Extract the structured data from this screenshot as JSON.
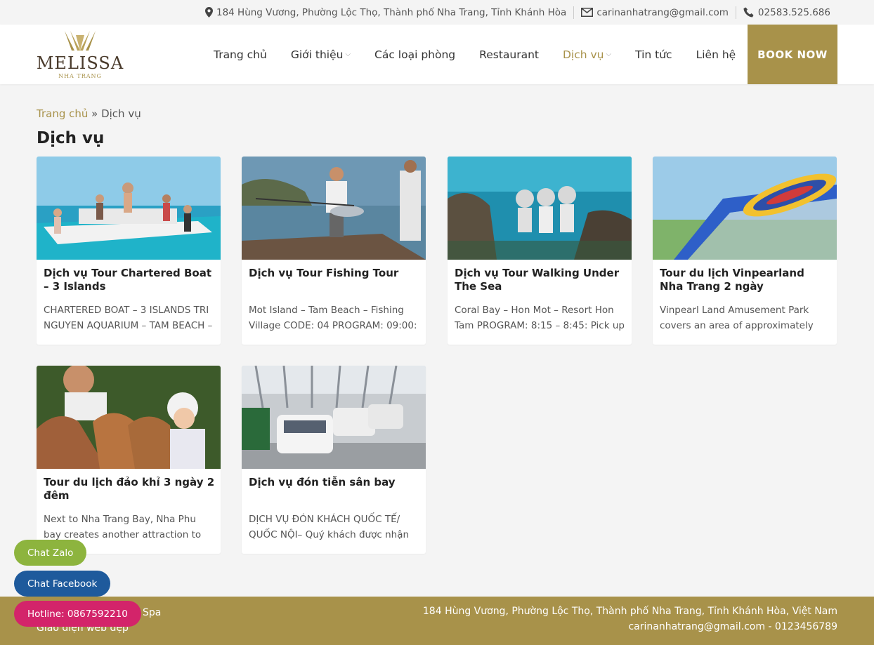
{
  "topbar": {
    "address": "184 Hùng Vương, Phường Lộc Thọ, Thành phố Nha Trang, Tỉnh Khánh Hòa",
    "email": "carinanhatrang@gmail.com",
    "phone": "02583.525.686"
  },
  "logo": {
    "brand": "MELISSA",
    "sub": "NHA TRANG"
  },
  "nav": [
    {
      "label": "Trang chủ",
      "dropdown": false
    },
    {
      "label": "Giới thiệu",
      "dropdown": true
    },
    {
      "label": "Các loại phòng",
      "dropdown": false
    },
    {
      "label": "Restaurant",
      "dropdown": false
    },
    {
      "label": "Dịch vụ",
      "dropdown": true
    },
    {
      "label": "Tin tức",
      "dropdown": false
    },
    {
      "label": "Liên hệ",
      "dropdown": false
    }
  ],
  "book_now": "BOOK NOW",
  "breadcrumb": {
    "home": "Trang chủ",
    "sep": " » ",
    "current": "Dịch vụ"
  },
  "page_title": "Dịch vụ",
  "cards": [
    {
      "title": "Dịch vụ Tour Chartered Boat – 3 Islands",
      "desc": "CHARTERED BOAT – 3 ISLANDS TRI NGUYEN AQUARIUM – TAM BEACH –"
    },
    {
      "title": "Dịch vụ Tour Fishing Tour",
      "desc": "Mot Island – Tam Beach – Fishing Village CODE: 04 PROGRAM: 09:00:"
    },
    {
      "title": "Dịch vụ Tour Walking Under The Sea",
      "desc": "Coral Bay – Hon Mot – Resort Hon Tam PROGRAM: 8:15 – 8:45: Pick up"
    },
    {
      "title": "Tour du lịch Vinpearland Nha Trang 2 ngày",
      "desc": "Vinpearl Land Amusement Park covers an area of approximately"
    },
    {
      "title": "Tour du lịch đảo khỉ 3 ngày 2 đêm",
      "desc": "Next to Nha Trang Bay, Nha Phu bay creates another attraction to tourist."
    },
    {
      "title": "Dịch vụ đón tiễn sân bay",
      "desc": "DỊCH VỤ ĐÓN KHÁCH QUỐC TẾ/ QUỐC NỘI– Quý khách được nhận"
    }
  ],
  "footer": {
    "left_line1": "ngWEB Restaurant & Spa",
    "left_line2": "Giao diện web đẹp",
    "right_line1": "184 Hùng Vương, Phường Lộc Thọ, Thành phố Nha Trang, Tỉnh Khánh Hòa, Việt Nam",
    "right_line2": "carinanhatrang@gmail.com - 0123456789"
  },
  "chat": {
    "zalo": "Chat Zalo",
    "facebook": "Chat Facebook",
    "hotline": "Hotline: 0867592210"
  },
  "colors": {
    "accent": "#a8924a",
    "zalo": "#8db43e",
    "facebook": "#1e5a9c",
    "hotline": "#d3246a"
  }
}
